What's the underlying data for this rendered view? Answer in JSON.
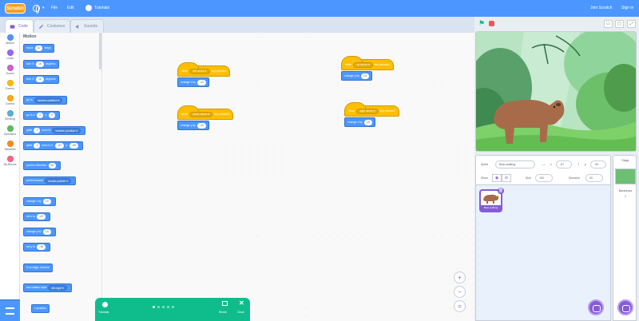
{
  "menubar": {
    "logo": "Scratch",
    "file": "File",
    "edit": "Edit",
    "tutorials": "Tutorials",
    "join": "Join Scratch",
    "signin": "Sign in"
  },
  "tabs": {
    "code": "Code",
    "costumes": "Costumes",
    "sounds": "Sounds"
  },
  "categories": [
    {
      "label": "Motion",
      "color": "#4c97ff"
    },
    {
      "label": "Looks",
      "color": "#9966ff"
    },
    {
      "label": "Sound",
      "color": "#cf63cf"
    },
    {
      "label": "Events",
      "color": "#ffbf00"
    },
    {
      "label": "Control",
      "color": "#ffab19"
    },
    {
      "label": "Sensing",
      "color": "#5cb1d6"
    },
    {
      "label": "Operators",
      "color": "#59c059"
    },
    {
      "label": "Variables",
      "color": "#ff8c1a"
    },
    {
      "label": "My Blocks",
      "color": "#ff6680"
    }
  ],
  "palette": {
    "title": "Motion",
    "move": {
      "a": "move",
      "v": "10",
      "b": "steps"
    },
    "turn_right": {
      "a": "turn ↻",
      "v": "15",
      "b": "degrees"
    },
    "turn_left": {
      "a": "turn ↺",
      "v": "15",
      "b": "degrees"
    },
    "goto": {
      "a": "go to",
      "d": "random position ▾"
    },
    "goto_xy": {
      "a": "go to x:",
      "x": "0",
      "b": "y:",
      "y": "0"
    },
    "glide_to": {
      "a": "glide",
      "v": "1",
      "b": "secs to",
      "d": "random position ▾"
    },
    "glide_xy": {
      "a": "glide",
      "v": "1",
      "b": "secs to x:",
      "x": "-67",
      "c": "y:",
      "y": "-90"
    },
    "point_dir": {
      "a": "point in direction",
      "v": "90"
    },
    "point_towards": {
      "a": "point towards",
      "d": "mouse-pointer ▾"
    },
    "change_x": {
      "a": "change x by",
      "v": "10"
    },
    "set_x": {
      "a": "set x to",
      "v": "-67"
    },
    "change_y": {
      "a": "change y by",
      "v": "10"
    },
    "set_y": {
      "a": "set y to",
      "v": "-90"
    },
    "bounce": "if on edge, bounce",
    "rotation": {
      "a": "set rotation style",
      "d": "left-right ▾"
    },
    "xpos": "x position"
  },
  "scripts": [
    {
      "event": "when",
      "key": "left arrow ▾",
      "suffix": "key pressed",
      "action": "change x by",
      "value": "-10"
    },
    {
      "event": "when",
      "key": "down arrow ▾",
      "suffix": "key pressed",
      "action": "change y by",
      "value": "-10"
    },
    {
      "event": "when",
      "key": "up arrow ▾",
      "suffix": "key pressed",
      "action": "change y by",
      "value": "10"
    },
    {
      "event": "when",
      "key": "right arrow ▾",
      "suffix": "key pressed",
      "action": "change x by",
      "value": "10"
    }
  ],
  "zoom": {
    "in": "+",
    "out": "−",
    "reset": "="
  },
  "tutorial": {
    "label": "Tutorials",
    "shrink": "Shrink",
    "close": "Close",
    "dots": 5,
    "active_dot": 0
  },
  "sprite_info": {
    "sprite_label": "Sprite",
    "sprite_name": "Bear-walking",
    "x_label": "x",
    "x": "-67",
    "y_label": "y",
    "y": "-90",
    "show_label": "Show",
    "size_label": "Size",
    "size": "100",
    "direction_label": "Direction",
    "direction": "90"
  },
  "sprite_list": [
    {
      "name": "Bear-walking"
    }
  ],
  "stage_pane": {
    "title": "Stage",
    "backdrops_label": "Backdrops",
    "backdrops_count": "1"
  }
}
